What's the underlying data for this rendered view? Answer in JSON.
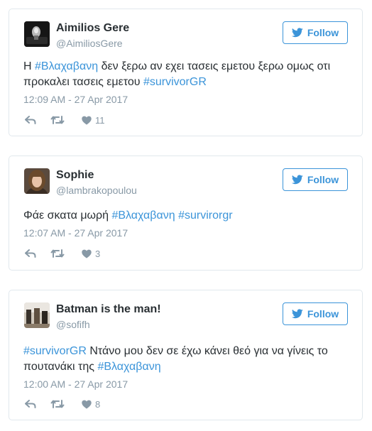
{
  "follow_label": "Follow",
  "accent": "#3b94d9",
  "icons": {
    "follow": "twitter-bird-icon",
    "reply": "reply-icon",
    "retweet": "retweet-icon",
    "like": "heart-icon"
  },
  "tweets": [
    {
      "name": "Aimilios Gere",
      "handle": "@AimiliosGere",
      "text": [
        {
          "t": "Η "
        },
        {
          "t": "#Βλαχαβανη",
          "tag": true
        },
        {
          "t": " δεν ξερω αν εχει τασεις εμετου ξερω ομως οτι προκαλει τασεις εμετου "
        },
        {
          "t": "#survivorGR",
          "tag": true
        }
      ],
      "time": "12:09 AM - 27 Apr 2017",
      "likes": "11"
    },
    {
      "name": "Sophie",
      "handle": "@lambrakopoulou",
      "text": [
        {
          "t": "Φάε σκατα μωρή "
        },
        {
          "t": "#Βλαχαβανη",
          "tag": true
        },
        {
          "t": " "
        },
        {
          "t": "#survirorgr",
          "tag": true
        }
      ],
      "time": "12:07 AM - 27 Apr 2017",
      "likes": "3"
    },
    {
      "name": "Batman is the man!",
      "handle": "@sofifh",
      "text": [
        {
          "t": "#survivorGR",
          "tag": true
        },
        {
          "t": " Ντάνο μου δεν σε έχω κάνει θεό για να γίνεις το πουτανάκι της "
        },
        {
          "t": "#Βλαχαβανη",
          "tag": true
        }
      ],
      "time": "12:00 AM - 27 Apr 2017",
      "likes": "8"
    }
  ]
}
